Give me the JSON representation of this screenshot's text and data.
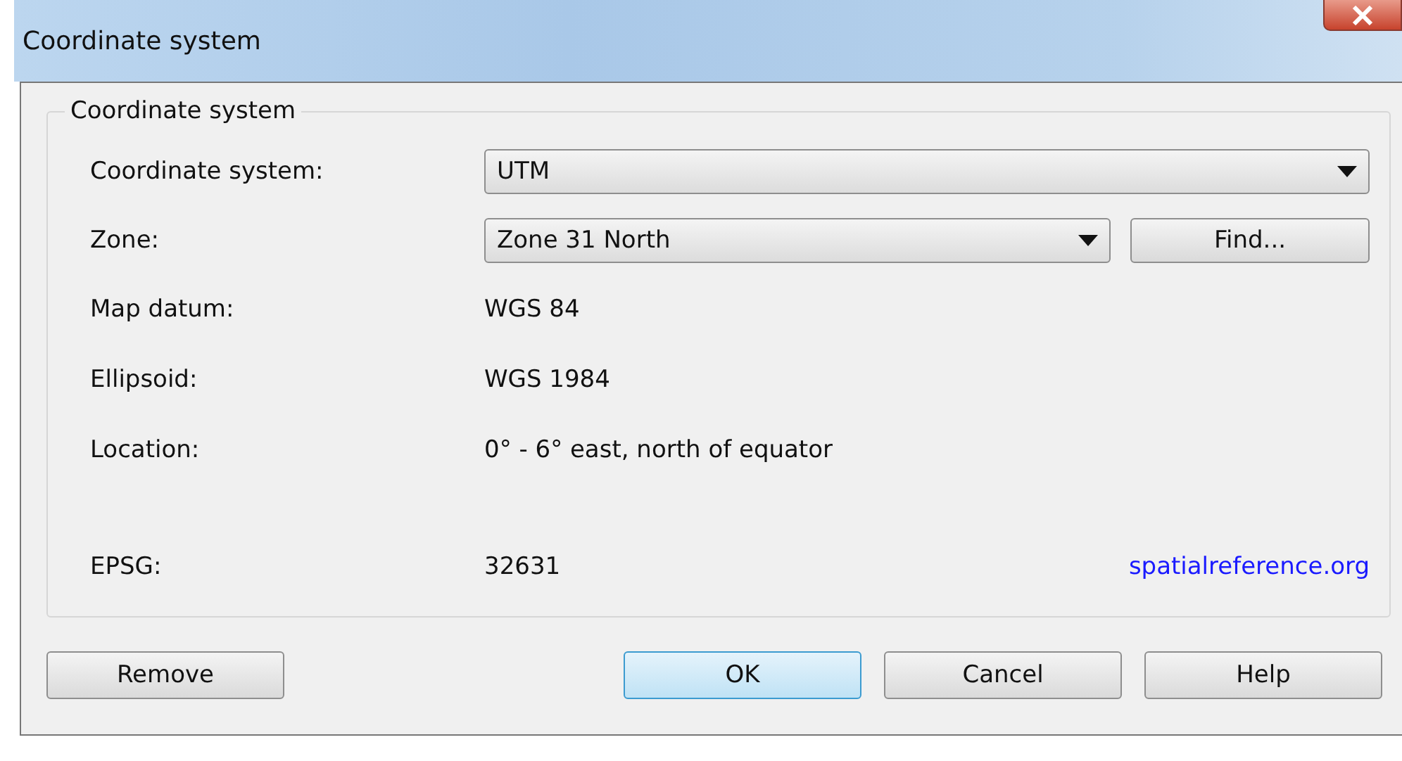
{
  "window": {
    "title": "Coordinate system"
  },
  "group": {
    "title": "Coordinate system",
    "rows": [
      {
        "kind": "dropdown",
        "label": "Coordinate system:",
        "value": "UTM"
      },
      {
        "kind": "dropdown-button",
        "label": "Zone:",
        "value": "Zone 31 North",
        "button": "Find..."
      },
      {
        "kind": "text",
        "label": "Map datum:",
        "value": "WGS 84"
      },
      {
        "kind": "text",
        "label": "Ellipsoid:",
        "value": "WGS 1984"
      },
      {
        "kind": "text",
        "label": "Location:",
        "value": "0° - 6° east, north of equator"
      },
      {
        "kind": "text-link",
        "label": "EPSG:",
        "value": "32631",
        "link": "spatialreference.org"
      }
    ]
  },
  "buttons": {
    "left": [
      {
        "label": "Remove",
        "default": false
      }
    ],
    "right": [
      {
        "label": "OK",
        "default": true
      },
      {
        "label": "Cancel",
        "default": false
      },
      {
        "label": "Help",
        "default": false
      }
    ]
  }
}
